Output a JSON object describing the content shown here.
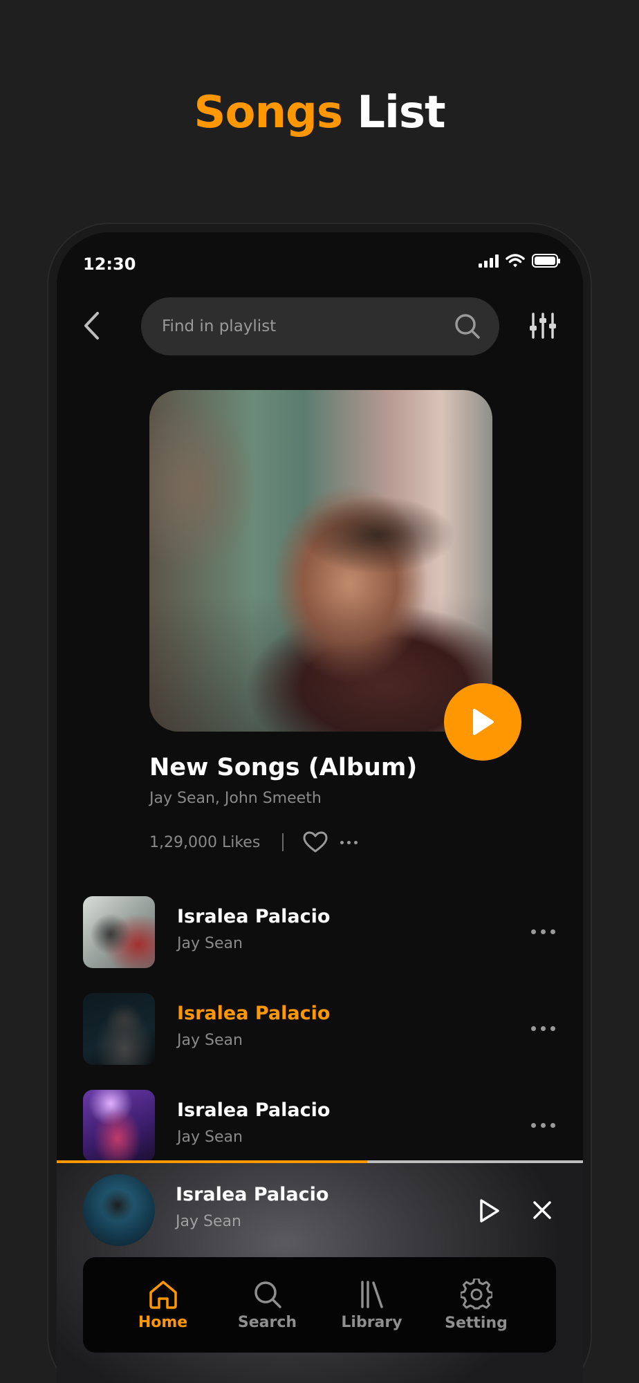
{
  "heading": {
    "accent": "Songs",
    "plain": "List"
  },
  "status": {
    "time": "12:30"
  },
  "search": {
    "placeholder": "Find in playlist"
  },
  "album": {
    "title": "New Songs (Album)",
    "artists": "Jay Sean, John Smeeth",
    "likes": "1,29,000 Likes"
  },
  "songs": [
    {
      "title": "Isralea Palacio",
      "artist": "Jay Sean",
      "active": false
    },
    {
      "title": "Isralea Palacio",
      "artist": "Jay Sean",
      "active": true
    },
    {
      "title": "Isralea Palacio",
      "artist": "Jay Sean",
      "active": false
    }
  ],
  "now_playing": {
    "title": "Isralea Palacio",
    "artist": "Jay Sean",
    "progress": 0.59
  },
  "nav": [
    {
      "label": "Home",
      "icon": "home-icon",
      "active": true
    },
    {
      "label": "Search",
      "icon": "search-icon",
      "active": false
    },
    {
      "label": "Library",
      "icon": "library-icon",
      "active": false
    },
    {
      "label": "Setting",
      "icon": "gear-icon",
      "active": false
    }
  ],
  "colors": {
    "accent": "#ff9800",
    "background": "#1f1f1f",
    "screen": "#0d0d0d"
  }
}
